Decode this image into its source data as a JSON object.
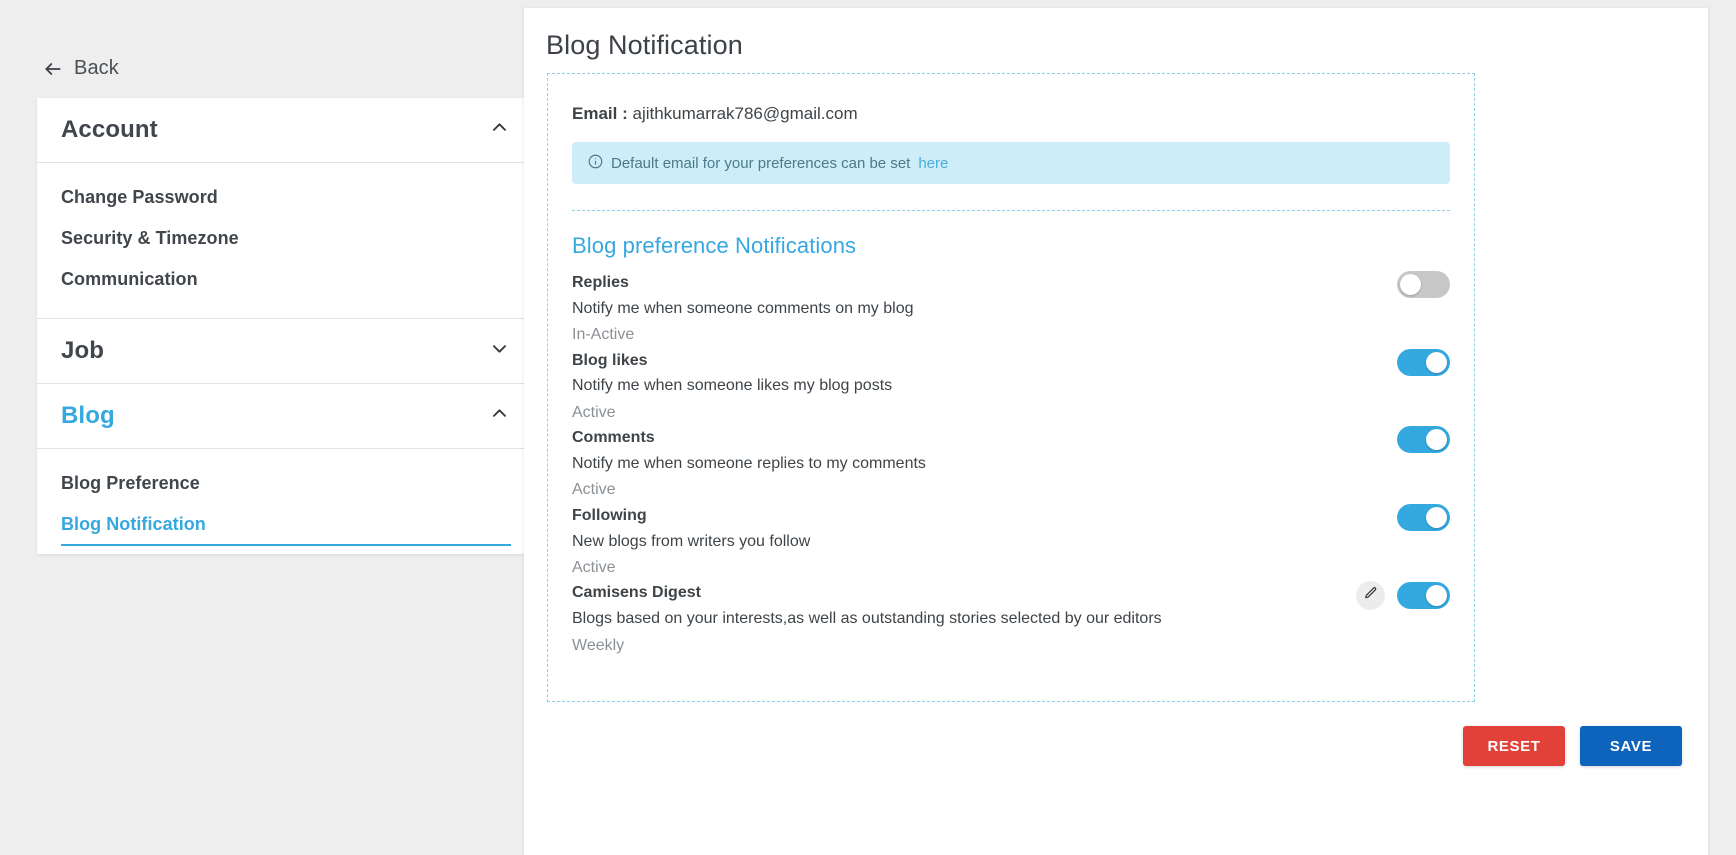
{
  "sidebar": {
    "back_label": "Back",
    "groups": [
      {
        "title": "Account",
        "expanded": true,
        "chevron": "chevron-up-icon",
        "items": [
          {
            "label": "Change Password",
            "selected": false
          },
          {
            "label": "Security & Timezone",
            "selected": false
          },
          {
            "label": "Communication",
            "selected": false
          }
        ]
      },
      {
        "title": "Job",
        "expanded": false,
        "chevron": "chevron-down-icon",
        "items": []
      },
      {
        "title": "Blog",
        "expanded": true,
        "active": true,
        "chevron": "chevron-up-icon",
        "items": [
          {
            "label": "Blog Preference",
            "selected": false
          },
          {
            "label": "Blog Notification",
            "selected": true
          }
        ]
      }
    ]
  },
  "main": {
    "page_title": "Blog Notification",
    "email_label": "Email :",
    "email_value": "ajithkumarrak786@gmail.com",
    "info_banner": {
      "icon": "info-circle-icon",
      "text": "Default email for your preferences can be set",
      "link_text": "here"
    },
    "section_title": "Blog preference Notifications",
    "preferences": [
      {
        "name": "Replies",
        "description": "Notify me when someone comments on my blog",
        "status": "In-Active",
        "toggle_on": false,
        "has_edit": false
      },
      {
        "name": "Blog likes",
        "description": "Notify me when someone likes my blog posts",
        "status": "Active",
        "toggle_on": true,
        "has_edit": false
      },
      {
        "name": "Comments",
        "description": "Notify me when someone replies to my comments",
        "status": "Active",
        "toggle_on": true,
        "has_edit": false
      },
      {
        "name": "Following",
        "description": "New blogs from writers you follow",
        "status": "Active",
        "toggle_on": true,
        "has_edit": false
      },
      {
        "name": "Camisens Digest",
        "description": "Blogs based on your interests,as well as outstanding stories selected by our editors",
        "status": "Weekly",
        "toggle_on": true,
        "has_edit": true,
        "edit_icon": "pencil-icon"
      }
    ],
    "actions": {
      "reset_label": "RESET",
      "save_label": "SAVE"
    }
  },
  "colors": {
    "accent_blue": "#36a8e0",
    "toggle_on": "#33a9e0",
    "toggle_off": "#c7c7c7",
    "banner_bg": "#cdedf8",
    "reset_red": "#e2413a",
    "save_blue": "#0e63bd",
    "page_bg": "#eeeeee"
  }
}
